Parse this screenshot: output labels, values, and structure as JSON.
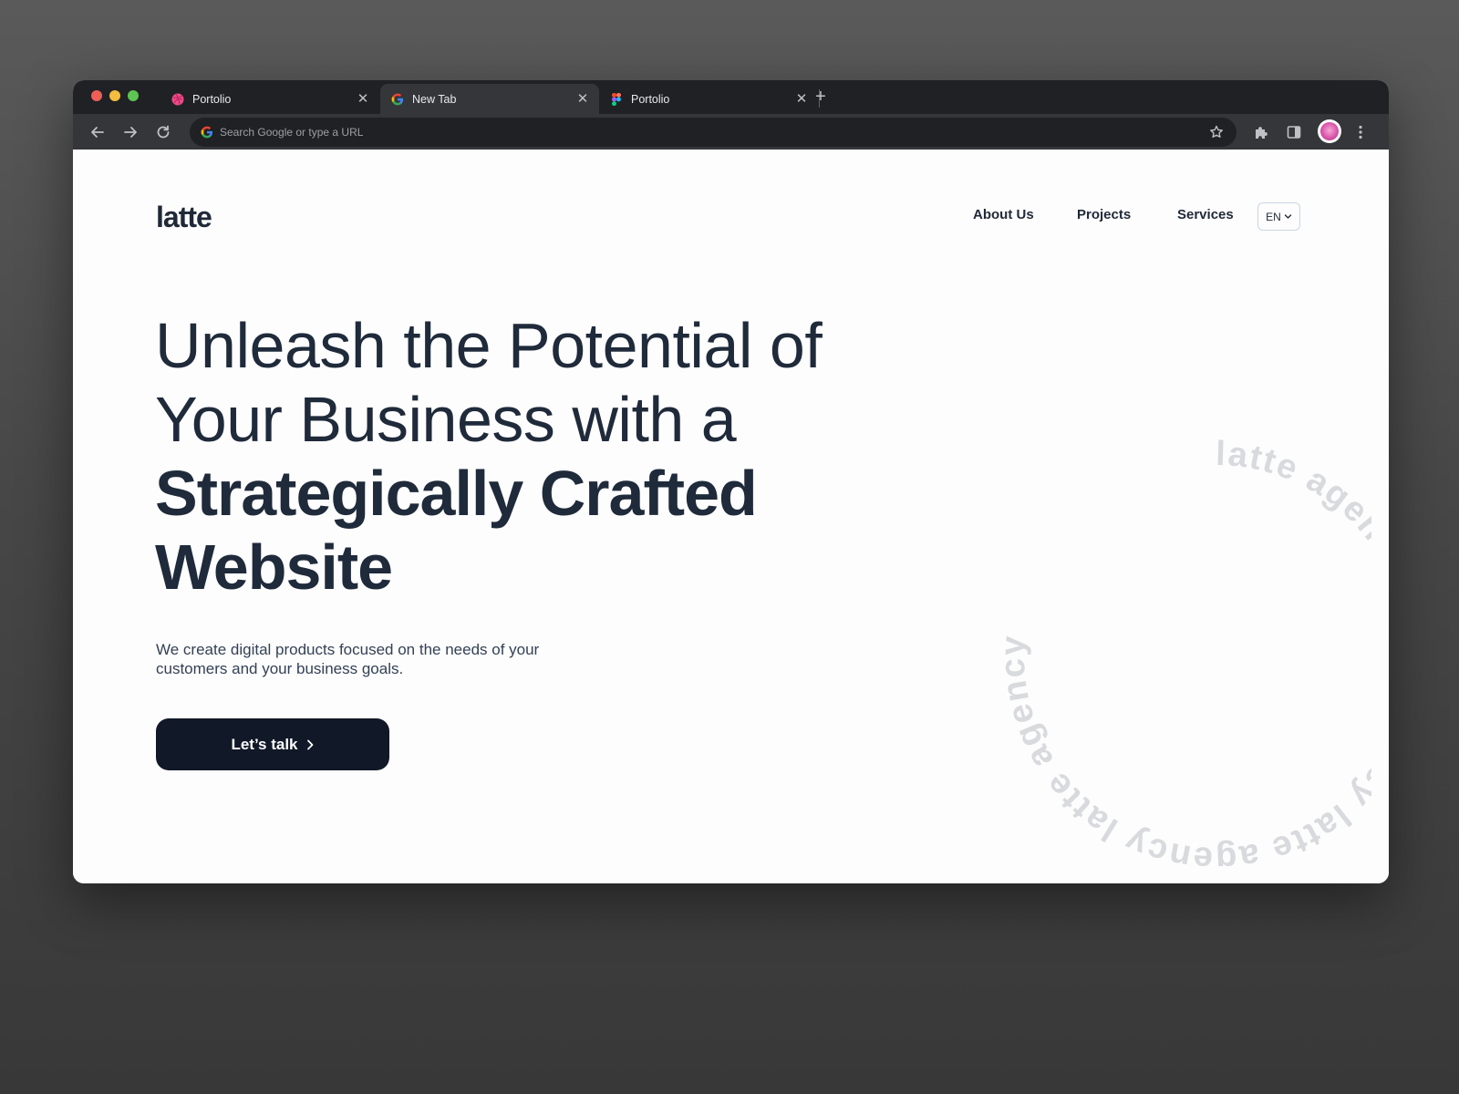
{
  "browser": {
    "tabs": [
      {
        "title": "Portolio",
        "favicon": "dribbble-icon",
        "active": false
      },
      {
        "title": "New Tab",
        "favicon": "google-icon",
        "active": true
      },
      {
        "title": "Portolio",
        "favicon": "figma-icon",
        "active": false
      }
    ],
    "close_glyph": "✕",
    "new_tab_glyph": "+",
    "omnibox": {
      "placeholder": "Search Google or type a URL",
      "value": ""
    }
  },
  "site": {
    "logo": "latte",
    "nav": [
      {
        "label": "About Us"
      },
      {
        "label": "Projects"
      },
      {
        "label": "Services"
      }
    ],
    "language": "EN",
    "hero": {
      "line1": "Unleash the Potential of",
      "line2": "Your Business with a",
      "line3": "Strategically Crafted",
      "line4": "Website",
      "subtitle": "We create digital products focused on the needs of your customers and your business goals.",
      "cta": "Let’s talk"
    },
    "ring_text": "latte agency  latte agency  latte agency  latte agency  "
  },
  "colors": {
    "accent_dark": "#111827",
    "text_dark": "#1f2a3a",
    "ring_text": "#d8dadd"
  }
}
